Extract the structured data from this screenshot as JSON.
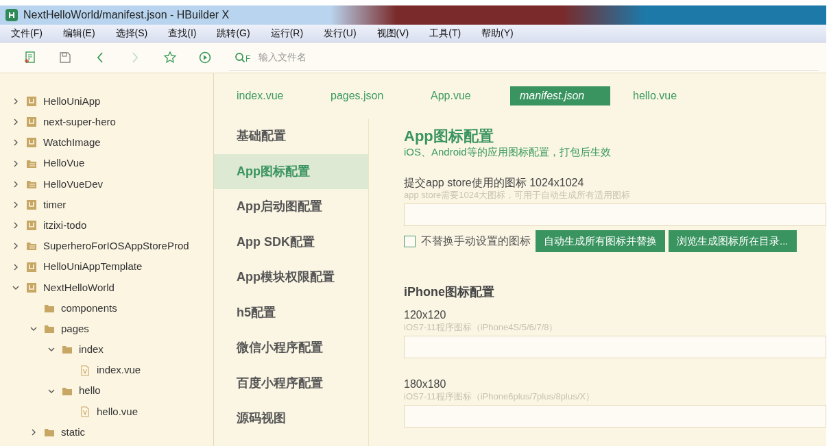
{
  "window": {
    "title": "NextHelloWorld/manifest.json - HBuilder X"
  },
  "menu": [
    "文件(F)",
    "编辑(E)",
    "选择(S)",
    "查找(I)",
    "跳转(G)",
    "运行(R)",
    "发行(U)",
    "视图(V)",
    "工具(T)",
    "帮助(Y)"
  ],
  "toolbar": {
    "buttons": [
      {
        "kind": "new-file"
      },
      {
        "kind": "save"
      },
      {
        "kind": "back"
      },
      {
        "kind": "forward",
        "disabled": true
      },
      {
        "kind": "star"
      },
      {
        "kind": "run"
      }
    ],
    "search_label": "F",
    "search_placeholder": "输入文件名"
  },
  "project_tree": [
    {
      "label": "HelloUniApp",
      "kind": "uni",
      "expanded": false
    },
    {
      "label": "next-super-hero",
      "kind": "uni",
      "expanded": false
    },
    {
      "label": "WatchImage",
      "kind": "uni",
      "expanded": false
    },
    {
      "label": "HelloVue",
      "kind": "web",
      "expanded": false
    },
    {
      "label": "HelloVueDev",
      "kind": "web",
      "expanded": false
    },
    {
      "label": "timer",
      "kind": "uni",
      "expanded": false
    },
    {
      "label": "itzixi-todo",
      "kind": "uni",
      "expanded": false
    },
    {
      "label": "SuperheroForIOSAppStoreProd",
      "kind": "web",
      "expanded": false
    },
    {
      "label": "HelloUniAppTemplate",
      "kind": "uni",
      "expanded": false
    },
    {
      "label": "NextHelloWorld",
      "kind": "uni",
      "expanded": true,
      "children": [
        {
          "label": "components",
          "kind": "folder"
        },
        {
          "label": "pages",
          "kind": "folder",
          "expanded": true,
          "children": [
            {
              "label": "index",
              "kind": "folder",
              "expanded": true,
              "children": [
                {
                  "label": "index.vue",
                  "kind": "file"
                }
              ]
            },
            {
              "label": "hello",
              "kind": "folder",
              "expanded": true,
              "children": [
                {
                  "label": "hello.vue",
                  "kind": "file"
                }
              ]
            }
          ]
        },
        {
          "label": "static",
          "kind": "folder",
          "expanded": false
        }
      ]
    }
  ],
  "tabs": [
    {
      "label": "index.vue",
      "selected": false
    },
    {
      "label": "pages.json",
      "selected": false
    },
    {
      "label": "App.vue",
      "selected": false
    },
    {
      "label": "manifest.json",
      "selected": true
    },
    {
      "label": "hello.vue",
      "selected": false
    }
  ],
  "settings_nav": [
    {
      "label": "基础配置",
      "selected": false
    },
    {
      "label": "App图标配置",
      "selected": true
    },
    {
      "label": "App启动图配置",
      "selected": false
    },
    {
      "label": "App SDK配置",
      "selected": false
    },
    {
      "label": "App模块权限配置",
      "selected": false
    },
    {
      "label": "h5配置",
      "selected": false
    },
    {
      "label": "微信小程序配置",
      "selected": false
    },
    {
      "label": "百度小程序配置",
      "selected": false
    },
    {
      "label": "源码视图",
      "selected": false
    }
  ],
  "panel": {
    "title": "App图标配置",
    "subtitle": "iOS、Android等的应用图标配置，打包后生效",
    "app_store": {
      "label": "提交app store使用的图标 1024x1024",
      "hint": "app store需要1024大图标，可用于自动生成所有适用图标"
    },
    "checkbox": {
      "label": "不替换手动设置的图标",
      "checked": false
    },
    "buttons": [
      "自动生成所有图标并替换",
      "浏览生成图标所在目录..."
    ],
    "section_title": "iPhone图标配置",
    "icons": [
      {
        "label": "120x120",
        "hint": "iOS7-11程序图标（iPhone4S/5/6/7/8）"
      },
      {
        "label": "180x180",
        "hint": "iOS7-11程序图标（iPhone6plus/7plus/8plus/X）"
      }
    ]
  }
}
